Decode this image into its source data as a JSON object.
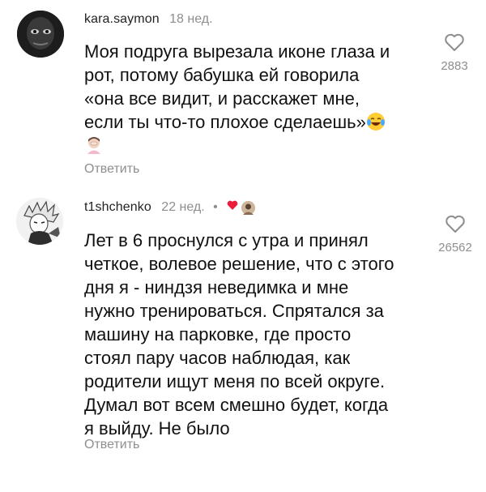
{
  "comments": [
    {
      "username": "kara.saymon",
      "time": "18 нед.",
      "text_lines": [
        "Моя подруга вырезала иконе глаза и",
        "рот, потому бабушка ей говорила",
        "«она все видит, и расскажет мне,",
        "если ты что-то плохое сделаешь»"
      ],
      "reply_label": "Ответить",
      "like_count": "2883"
    },
    {
      "username": "t1shchenko",
      "time": "22 нед.",
      "dot": "•",
      "text_lines": [
        "Лет в 6 проснулся с утра и принял",
        "четкое, волевое решение, что с этого",
        "дня я - ниндзя неведимка и мне",
        "нужно тренироваться. Спрятался за",
        "машину на парковке, где просто",
        "стоял пару часов наблюдая, как",
        "родители ищут меня по всей округе.",
        "Думал вот всем смешно будет, когда",
        "я выйду. Не было"
      ],
      "reply_label": "Ответить",
      "like_count": "26562"
    }
  ],
  "icons": {
    "like": "heart-outline-icon",
    "laugh": "tears-of-joy-emoji-icon",
    "facepalm": "facepalm-emoji-icon",
    "author_liked": "red-heart-icon"
  },
  "colors": {
    "text": "#111111",
    "muted": "#8e8e8e",
    "heart_red": "#ed1c3a"
  }
}
